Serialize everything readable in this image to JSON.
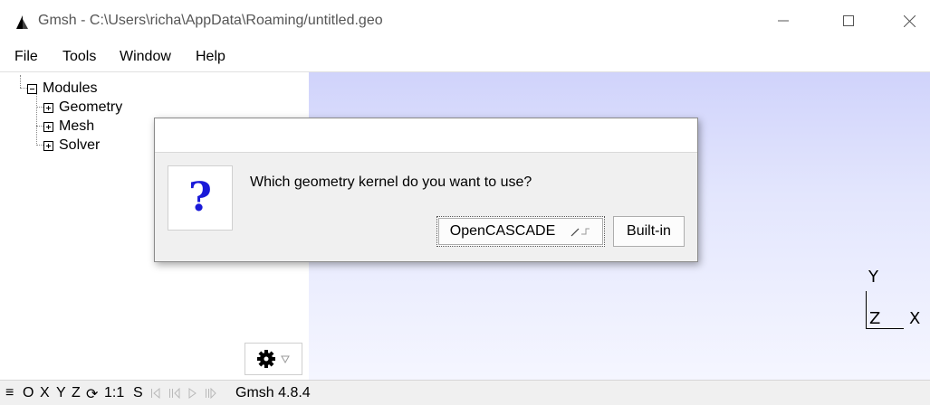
{
  "window": {
    "title": "Gmsh - C:\\Users\\richa\\AppData\\Roaming/untitled.geo",
    "controls": [
      "minimize",
      "maximize",
      "close"
    ]
  },
  "menu": {
    "items": [
      {
        "label": "File"
      },
      {
        "label": "Tools"
      },
      {
        "label": "Window"
      },
      {
        "label": "Help"
      }
    ]
  },
  "tree": {
    "root": "Modules",
    "children": [
      "Geometry",
      "Mesh",
      "Solver"
    ]
  },
  "dialog": {
    "icon_glyph": "?",
    "message": "Which geometry kernel do you want to use?",
    "buttons": [
      {
        "label": "OpenCASCADE"
      },
      {
        "label": "Built-in"
      }
    ]
  },
  "axes": {
    "y": "Y",
    "z": "Z",
    "x": "X"
  },
  "statusbar": {
    "menu_glyph": "≡",
    "items": [
      "O",
      "X",
      "Y",
      "Z"
    ],
    "rotate_glyph": "⟳",
    "scale": "1:1",
    "s": "S",
    "version": "Gmsh 4.8.4"
  },
  "colors": {
    "graphics_top": "#d0d3fb",
    "graphics_bottom": "#f5f6ff",
    "question_mark": "#1a1ad8"
  }
}
